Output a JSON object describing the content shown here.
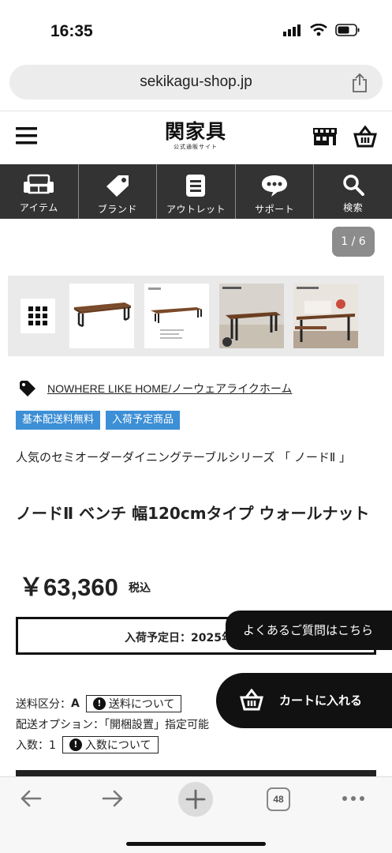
{
  "status": {
    "time": "16:35"
  },
  "browser": {
    "url": "sekikagu-shop.jp",
    "tab_count": "48"
  },
  "header": {
    "logo_main": "関家具",
    "logo_sub": "公式通販サイト"
  },
  "nav": [
    {
      "label": "アイテム",
      "icon": "sofa-icon"
    },
    {
      "label": "ブランド",
      "icon": "tag-icon"
    },
    {
      "label": "アウトレット",
      "icon": "document-icon"
    },
    {
      "label": "サポート",
      "icon": "chat-bubble-icon"
    },
    {
      "label": "検索",
      "icon": "search-icon"
    }
  ],
  "gallery": {
    "counter": "1 / 6"
  },
  "product": {
    "brand": "NOWHERE LIKE HOME/ノーウェアライクホーム",
    "badges": [
      "基本配送料無料",
      "入荷予定商品"
    ],
    "subtitle": "人気のセミオーダーダイニングテーブルシリーズ 「 ノードⅡ 」",
    "title": "ノードⅡ ベンチ 幅120cmタイプ ウォールナット",
    "price": "￥63,360",
    "tax": "税込",
    "arrival": "入荷予定日：2025年",
    "shipping_label": "送料区分：",
    "shipping_class": "A",
    "shipping_button": "送料について",
    "delivery_option": "配送オプション：「開梱設置」指定可能",
    "quantity_label": "入数：1",
    "quantity_button": "入数について"
  },
  "floating": {
    "faq": "よくあるご質問はこちら",
    "cart": "カートに入れる"
  }
}
